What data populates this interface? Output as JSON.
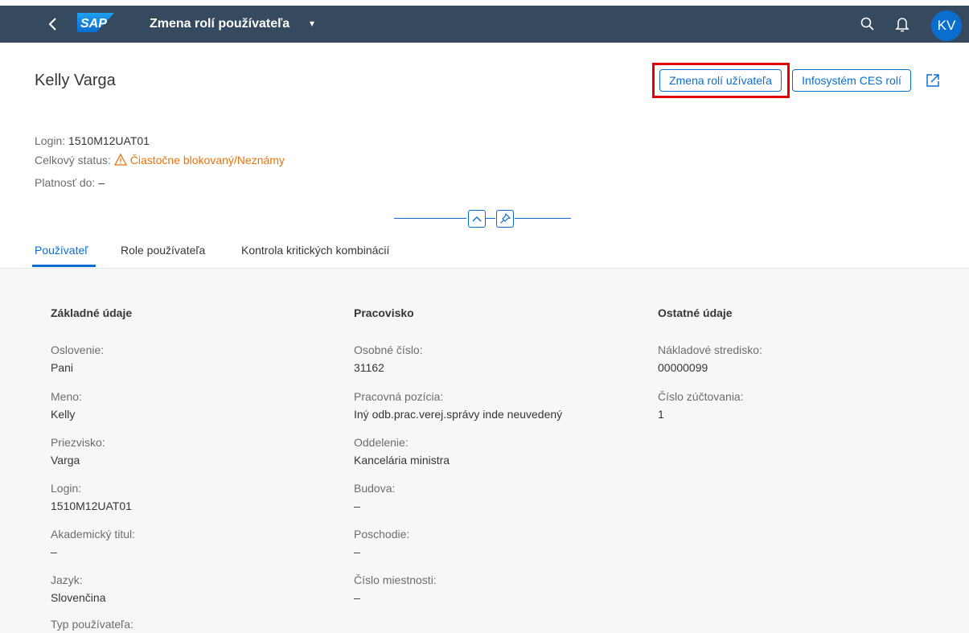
{
  "shell": {
    "title": "Zmena rolí používateľa",
    "title_caret": "▾",
    "avatar_initials": "KV",
    "logo_text": "SAP"
  },
  "header": {
    "name": "Kelly Varga",
    "btn_change_roles": "Zmena rolí užívateľa",
    "btn_infosystem": "Infosystém CES rolí",
    "login_label": "Login:",
    "login_value": "1510M12UAT01",
    "status_label": "Celkový status:",
    "status_value": "Čiastočne blokovaný/Neznámy",
    "valid_label": "Platnosť do:",
    "valid_value": "–"
  },
  "tabs": [
    "Používateľ",
    "Role používateľa",
    "Kontrola kritických kombinácií"
  ],
  "sections": {
    "basic": {
      "title": "Základné údaje",
      "fields": [
        {
          "label": "Oslovenie:",
          "value": "Pani"
        },
        {
          "label": "Meno:",
          "value": "Kelly"
        },
        {
          "label": "Priezvisko:",
          "value": "Varga"
        },
        {
          "label": "Login:",
          "value": "1510M12UAT01"
        },
        {
          "label": "Akademický titul:",
          "value": "–"
        },
        {
          "label": "Jazyk:",
          "value": "Slovenčina"
        },
        {
          "label": "Typ používateľa:",
          "value": ""
        }
      ]
    },
    "workplace": {
      "title": "Pracovisko",
      "fields": [
        {
          "label": "Osobné číslo:",
          "value": "31162"
        },
        {
          "label": "Pracovná pozícia:",
          "value": "Iný odb.prac.verej.správy inde neuvedený"
        },
        {
          "label": "Oddelenie:",
          "value": "Kancelária ministra"
        },
        {
          "label": "Budova:",
          "value": "–"
        },
        {
          "label": "Poschodie:",
          "value": "–"
        },
        {
          "label": "Číslo miestnosti:",
          "value": "–"
        }
      ]
    },
    "other": {
      "title": "Ostatné údaje",
      "fields": [
        {
          "label": "Nákladové stredisko:",
          "value": "00000099"
        },
        {
          "label": "Číslo zúčtovania:",
          "value": "1"
        }
      ]
    }
  },
  "colors": {
    "shell": "#354a5f",
    "accent": "#0a6ed1",
    "warning": "#e9730c",
    "highlight": "#e40000"
  }
}
